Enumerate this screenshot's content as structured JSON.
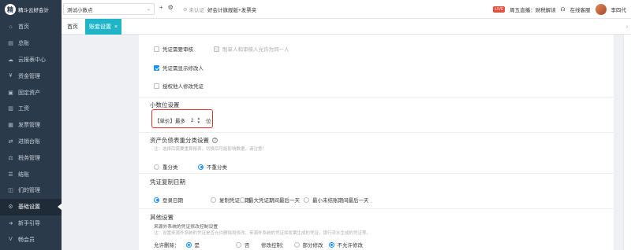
{
  "brand": {
    "logo": "精",
    "name": "精斗云好会计"
  },
  "topbar": {
    "account": "测试小数点",
    "auth_status": "未认证",
    "auth_name": "好会计旗舰版+发票夹",
    "live_badge": "LIVE",
    "live_text": "周五直播：财税解读",
    "service": "在线客服",
    "user": "李四代"
  },
  "sidebar": {
    "items": [
      {
        "icon": "⌂",
        "label": "首页"
      },
      {
        "icon": "▤",
        "label": "总账"
      },
      {
        "icon": "☁",
        "label": "云报表中心"
      },
      {
        "icon": "¥",
        "label": "资金管理"
      },
      {
        "icon": "▣",
        "label": "固定资产"
      },
      {
        "icon": "▥",
        "label": "工资"
      },
      {
        "icon": "▦",
        "label": "发票管理"
      },
      {
        "icon": "⇄",
        "label": "进销台账"
      },
      {
        "icon": "⚖",
        "label": "税务管理"
      },
      {
        "icon": "☰",
        "label": "结账"
      },
      {
        "icon": "◫",
        "label": "们的管理"
      },
      {
        "icon": "⚙",
        "label": "基础设置"
      },
      {
        "icon": "➜",
        "label": "新手引导"
      },
      {
        "icon": "V",
        "label": "畅会员"
      }
    ]
  },
  "tabs": {
    "home": "首页",
    "active": "账套设置",
    "close": "×"
  },
  "content": {
    "voucher_review": "凭证需要审核",
    "same_person": "制单人和审核人允许为同一人",
    "show_modifier": "凭证需显示修改人",
    "allow_edit_other": "授权他人修改凭证",
    "decimal_title": "小数位设置",
    "decimal_label": "【单价】最多",
    "decimal_value": "2",
    "decimal_unit": "位",
    "balance_title": "资产负债表重分类设置",
    "balance_note": "注：选择后需要重算报表，切换后可能影响数据，请注意！",
    "reclass_opt": "重分类",
    "no_reclass_opt": "不重分类",
    "copy_title": "凭证复制日期",
    "copy_opts": [
      "登录日期",
      "复制凭证日期",
      "最大凭证期间最后一天",
      "最小未结账期间最后一天"
    ],
    "other_title": "其他设置",
    "other_sub": "来源外系统的凭证修改控制设置",
    "other_note": "注：设置来源外系统的凭证是否允许删除和修改，来源外系统的凭证如发票生成的凭证，银行流水生成的凭证等。",
    "allow_delete_label": "允许删除：",
    "yes": "是",
    "no": "否",
    "modify_label": "修改控制：",
    "partial_modify": "部分修改",
    "no_modify": "不允许修改"
  }
}
